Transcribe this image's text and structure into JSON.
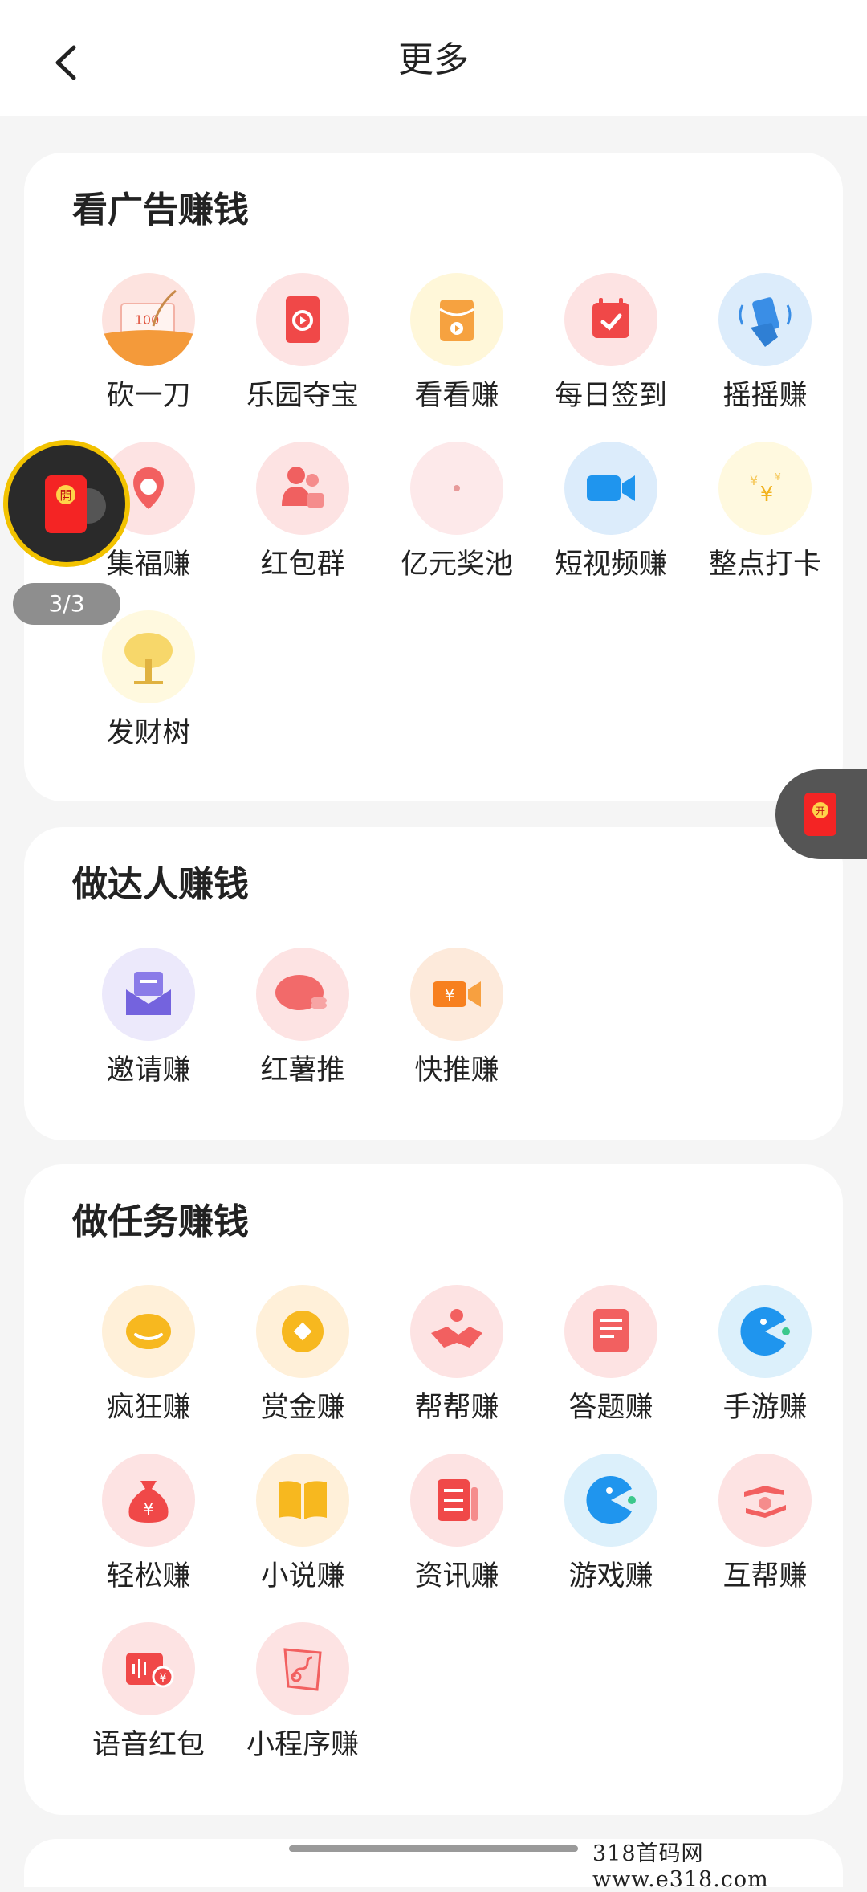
{
  "header": {
    "title": "更多"
  },
  "sections": [
    {
      "title": "看广告赚钱",
      "items": [
        {
          "label": "砍一刀",
          "icon": "cut-knife-icon",
          "value_text": "100"
        },
        {
          "label": "乐园夺宝",
          "icon": "red-envelope-icon"
        },
        {
          "label": "看看赚",
          "icon": "video-envelope-icon"
        },
        {
          "label": "每日签到",
          "icon": "calendar-check-icon"
        },
        {
          "label": "摇摇赚",
          "icon": "shake-phone-icon"
        },
        {
          "label": "集福赚",
          "icon": "fortune-icon"
        },
        {
          "label": "红包群",
          "icon": "group-users-icon"
        },
        {
          "label": "亿元奖池",
          "icon": "prize-pool-icon"
        },
        {
          "label": "短视频赚",
          "icon": "video-camera-icon"
        },
        {
          "label": "整点打卡",
          "icon": "yen-coins-icon"
        },
        {
          "label": "发财树",
          "icon": "money-tree-icon"
        }
      ]
    },
    {
      "title": "做达人赚钱",
      "items": [
        {
          "label": "邀请赚",
          "icon": "invite-mail-icon"
        },
        {
          "label": "红薯推",
          "icon": "sweet-potato-icon"
        },
        {
          "label": "快推赚",
          "icon": "yen-video-icon"
        }
      ]
    },
    {
      "title": "做任务赚钱",
      "items": [
        {
          "label": "疯狂赚",
          "icon": "smile-coin-icon"
        },
        {
          "label": "赏金赚",
          "icon": "gold-coin-icon"
        },
        {
          "label": "帮帮赚",
          "icon": "handshake-icon"
        },
        {
          "label": "答题赚",
          "icon": "document-edit-icon"
        },
        {
          "label": "手游赚",
          "icon": "pacman-icon"
        },
        {
          "label": "轻松赚",
          "icon": "money-bag-icon"
        },
        {
          "label": "小说赚",
          "icon": "open-book-icon"
        },
        {
          "label": "资讯赚",
          "icon": "news-icon"
        },
        {
          "label": "游戏赚",
          "icon": "pacman-icon"
        },
        {
          "label": "互帮赚",
          "icon": "hand-coin-icon"
        },
        {
          "label": "语音红包",
          "icon": "voice-yen-icon"
        },
        {
          "label": "小程序赚",
          "icon": "mini-program-icon"
        }
      ]
    }
  ],
  "floating": {
    "left_badge_char": "開",
    "counter": "3/3",
    "right_badge_char": "开"
  },
  "watermark": "318首码网 www.e318.com"
}
